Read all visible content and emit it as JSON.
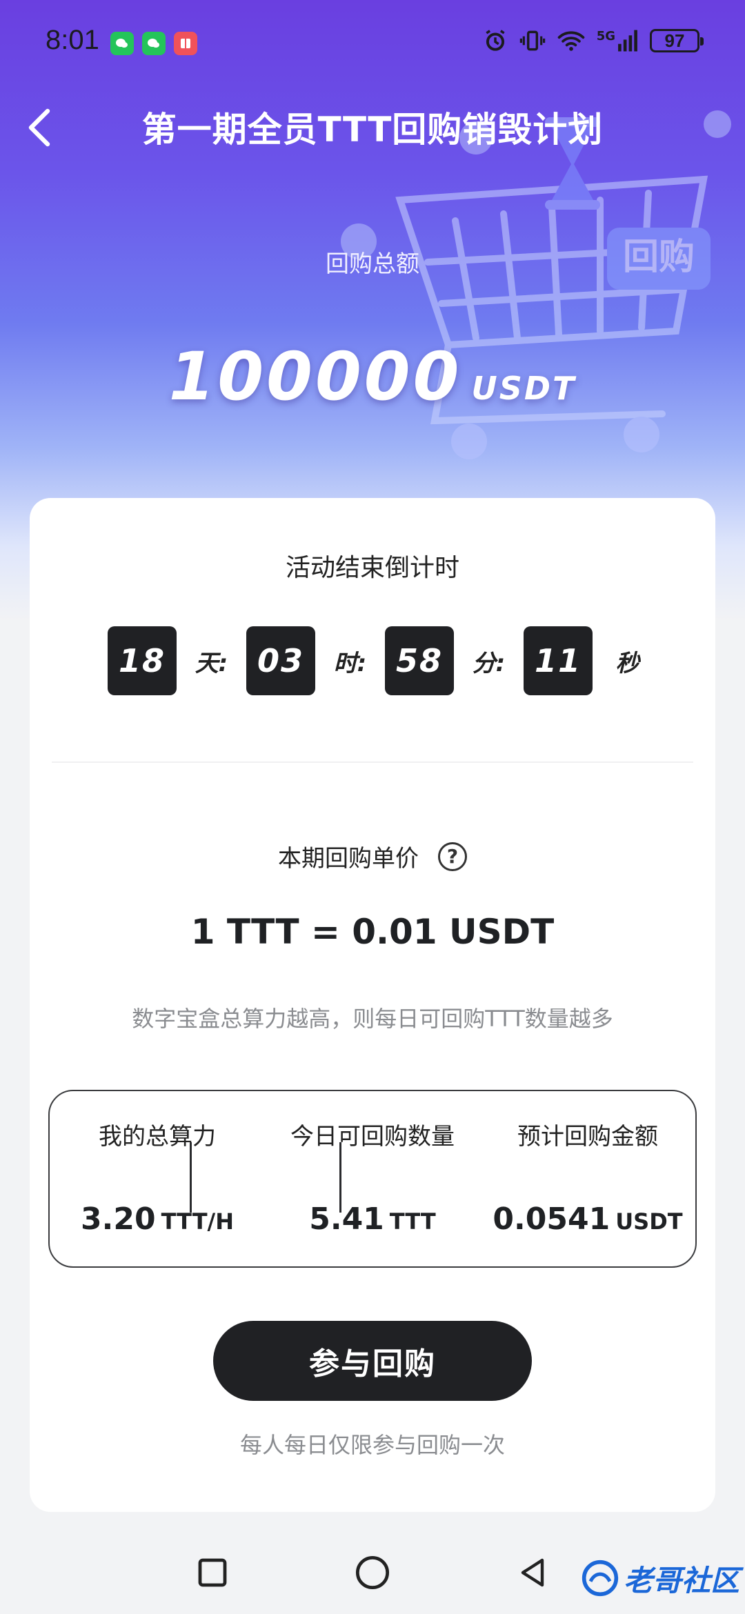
{
  "status_bar": {
    "time": "8:01",
    "network": "5G",
    "battery": "97"
  },
  "header": {
    "title": "第一期全员TTT回购销毁计划"
  },
  "hero": {
    "total_label": "回购总额",
    "total_amount": "100000",
    "total_unit": "USDT",
    "art_tag": "回购"
  },
  "countdown": {
    "title": "活动结束倒计时",
    "days": "18",
    "days_unit": "天:",
    "hours": "03",
    "hours_unit": "时:",
    "minutes": "58",
    "minutes_unit": "分:",
    "seconds": "11",
    "seconds_unit": "秒"
  },
  "price": {
    "label": "本期回购单价",
    "help_symbol": "?",
    "value": "1 TTT = 0.01 USDT",
    "hint": "数字宝盒总算力越高，则每日可回购TTT数量越多"
  },
  "stats": [
    {
      "label": "我的总算力",
      "value": "3.20",
      "unit": "TTT/H"
    },
    {
      "label": "今日可回购数量",
      "value": "5.41",
      "unit": "TTT"
    },
    {
      "label": "预计回购金额",
      "value": "0.0541",
      "unit": "USDT"
    }
  ],
  "action": {
    "button_label": "参与回购",
    "footnote": "每人每日仅限参与回购一次"
  },
  "watermark": {
    "text": "老哥社区"
  },
  "colors": {
    "hero_top": "#6a3fe0",
    "card_bg": "#ffffff",
    "dark": "#202124",
    "muted_text": "#8a8c90"
  }
}
